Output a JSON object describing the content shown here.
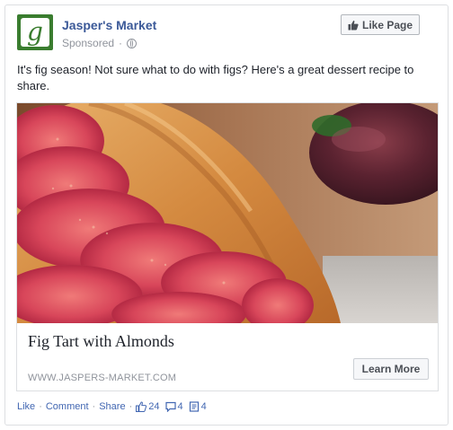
{
  "header": {
    "page_name": "Jasper's Market",
    "sponsored": "Sponsored",
    "sep_dot": "·",
    "avatar_letter": "g",
    "like_page_label": "Like Page"
  },
  "post": {
    "text": "It's fig season! Not sure what to do with figs? Here's a great dessert recipe to share."
  },
  "link": {
    "title": "Fig Tart with Almonds",
    "domain": "WWW.JASPERS-MARKET.COM",
    "cta_label": "Learn More"
  },
  "footer": {
    "like": "Like",
    "comment": "Comment",
    "share": "Share",
    "dot": "·",
    "likes_count": "24",
    "comments_count": "4",
    "shares_count": "4"
  },
  "colors": {
    "brand_blue": "#3b5998",
    "link_blue": "#4267b2",
    "avatar_green": "#3a7d2f"
  }
}
